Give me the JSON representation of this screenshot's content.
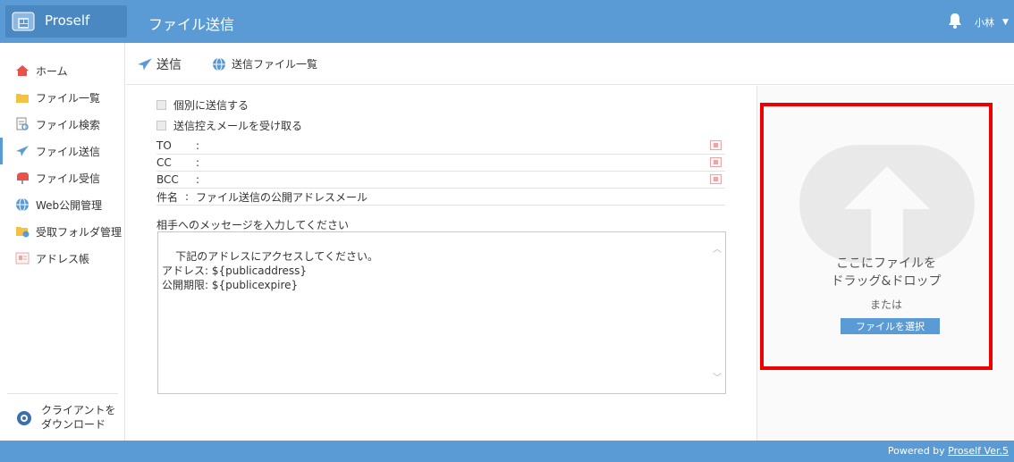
{
  "header": {
    "brand": "Proself",
    "title": "ファイル送信",
    "username": "小林",
    "caret": "▼"
  },
  "sidebar": {
    "items": [
      {
        "label": "ホーム",
        "icon": "home-icon"
      },
      {
        "label": "ファイル一覧",
        "icon": "folder-icon"
      },
      {
        "label": "ファイル検索",
        "icon": "file-search-icon"
      },
      {
        "label": "ファイル送信",
        "icon": "paper-plane-icon",
        "active": true
      },
      {
        "label": "ファイル受信",
        "icon": "mailbox-icon"
      },
      {
        "label": "Web公開管理",
        "icon": "globe-icon"
      },
      {
        "label": "受取フォルダ管理",
        "icon": "receive-folder-icon"
      },
      {
        "label": "アドレス帳",
        "icon": "address-book-icon"
      }
    ],
    "download_line1": "クライアントを",
    "download_line2": "ダウンロード"
  },
  "tabs": {
    "send": "送信",
    "list": "送信ファイル一覧"
  },
  "form": {
    "individual_label": "個別に送信する",
    "copy_label": "送信控えメールを受け取る",
    "to_label": "TO",
    "cc_label": "CC",
    "bcc_label": "BCC",
    "subject_label": "件名",
    "separator": ":",
    "subject_value": "ファイル送信の公開アドレスメール",
    "message_label": "相手へのメッセージを入力してください",
    "message_value": "下記のアドレスにアクセスしてください。\nアドレス: ${publicaddress}\n公開期限: ${publicexpire}"
  },
  "dropzone": {
    "line1": "ここにファイルを",
    "line2": "ドラッグ&ドロップ",
    "or": "または",
    "select_button": "ファイルを選択"
  },
  "footer": {
    "prefix": "Powered by ",
    "link": "Proself Ver.5"
  },
  "colors": {
    "header": "#5b9bd5",
    "highlight": "#ee0000",
    "accent": "#5b9bd5"
  }
}
